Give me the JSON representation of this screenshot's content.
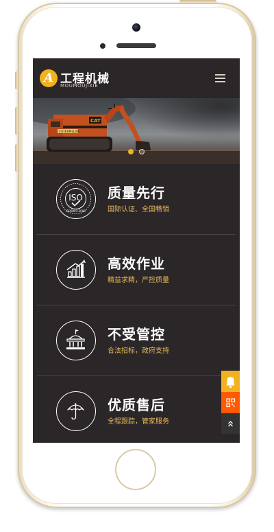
{
  "header": {
    "logo_letter": "A",
    "site_title": "工程机械",
    "site_subtitle": "MOUMOUJIXIE"
  },
  "banner": {
    "machine_label": "CAT",
    "machine_model": "CATERPILLAR",
    "slides_count": 2,
    "active_slide": 1
  },
  "features": [
    {
      "title": "质量先行",
      "desc": "国际认证、全国畅销",
      "icon": "iso-certification-icon",
      "iso_text": "ISO",
      "iso_number": "ISO9001:2000"
    },
    {
      "title": "高效作业",
      "desc": "精益求精，严控质量",
      "icon": "growth-chart-icon"
    },
    {
      "title": "不受管控",
      "desc": "合法招标，政府支持",
      "icon": "government-building-icon"
    },
    {
      "title": "优质售后",
      "desc": "全程跟踪，管家服务",
      "icon": "umbrella-icon"
    }
  ],
  "float_buttons": [
    {
      "icon": "bell-icon",
      "color": "#f0b21f"
    },
    {
      "icon": "qr-code-icon",
      "color": "#ff5a00"
    },
    {
      "icon": "back-to-top-icon",
      "color": "#333333"
    }
  ],
  "colors": {
    "screen_bg": "#2b2628",
    "accent_yellow": "#f0b21f",
    "desc_gold": "#e7b95a",
    "accent_orange": "#ff5a00"
  }
}
